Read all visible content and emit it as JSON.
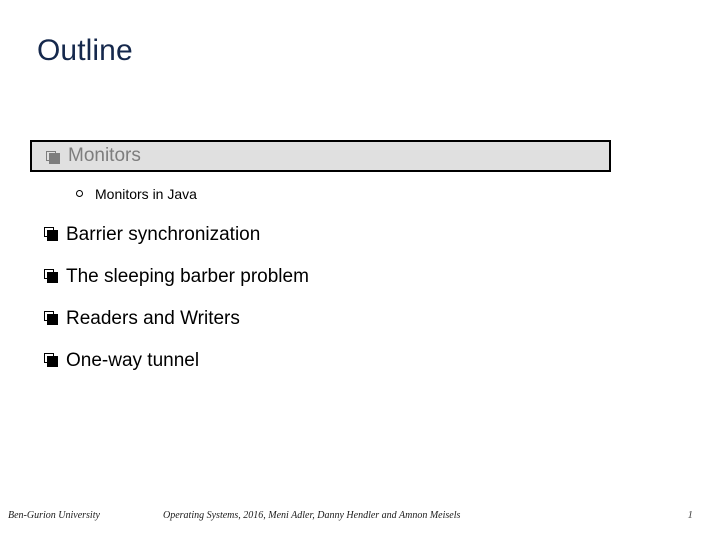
{
  "slide": {
    "title": "Outline",
    "title_color": "#15284c",
    "background_color": "#ffffff",
    "highlight": {
      "background_color": "#e0e0e0",
      "border_color": "#000000",
      "text_color": "#7d7d7d"
    },
    "bullets": [
      {
        "level": 1,
        "marker": "square-bullet-icon",
        "label": "Monitors",
        "highlighted": true
      },
      {
        "level": 2,
        "marker": "circle-bullet-icon",
        "label": "Monitors in Java",
        "highlighted": false
      },
      {
        "level": 1,
        "marker": "square-bullet-icon",
        "label": "Barrier synchronization",
        "highlighted": false
      },
      {
        "level": 1,
        "marker": "square-bullet-icon",
        "label": "The sleeping barber problem",
        "highlighted": false
      },
      {
        "level": 1,
        "marker": "square-bullet-icon",
        "label": "Readers and Writers",
        "highlighted": false
      },
      {
        "level": 1,
        "marker": "square-bullet-icon",
        "label": "One-way tunnel",
        "highlighted": false
      }
    ],
    "footer": {
      "left": "Ben-Gurion University",
      "center": "Operating Systems, 2016, Meni Adler, Danny Hendler and Amnon Meisels",
      "page_number": "1"
    }
  }
}
